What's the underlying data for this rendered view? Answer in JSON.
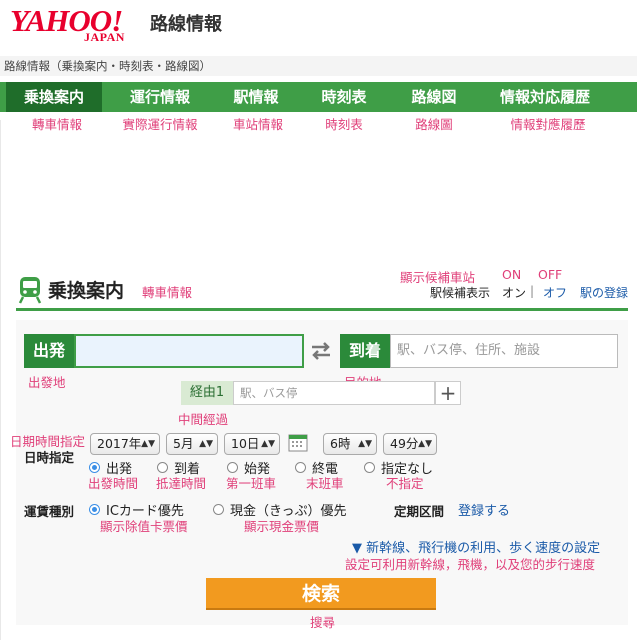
{
  "brand": {
    "logo_text": "YAHOO!",
    "logo_sub": "JAPAN",
    "service_title": "路線情報"
  },
  "breadcrumb": "路線情報（乗換案内・時刻表・路線図）",
  "nav": {
    "tabs": [
      {
        "label": "乗換案内",
        "sub": "轉車情報",
        "active": true
      },
      {
        "label": "運行情報",
        "sub": "實際運行情報"
      },
      {
        "label": "駅情報",
        "sub": "車站情報"
      },
      {
        "label": "時刻表",
        "sub": "時刻表"
      },
      {
        "label": "路線図",
        "sub": "路線圖"
      },
      {
        "label": "情報対応履歴",
        "sub": "情報對應履歷"
      }
    ]
  },
  "candidate": {
    "note": "顯示候補車站",
    "note_on": "ON",
    "note_off": "OFF",
    "label": "駅候補表示",
    "on": "オン",
    "sep": "|",
    "off": "オフ",
    "register": "駅の登録"
  },
  "section": {
    "title": "乗換案内",
    "title_note": "轉車情報"
  },
  "departure": {
    "label": "出発",
    "value": "",
    "note": "出發地"
  },
  "arrival": {
    "label": "到着",
    "placeholder": "駅、バス停、住所、施設",
    "note": "目的地"
  },
  "via": {
    "label": "経由1",
    "placeholder": "駅、バス停",
    "add": "+",
    "note": "中間經過"
  },
  "datetime": {
    "note": "日期時間指定",
    "label": "日時指定",
    "year": "2017年",
    "month": "5月",
    "day": "10日",
    "hour": "6時",
    "minute": "49分",
    "options": [
      {
        "label": "出発",
        "note": "出發時間",
        "checked": true
      },
      {
        "label": "到着",
        "note": "抵達時間"
      },
      {
        "label": "始発",
        "note": "第一班車"
      },
      {
        "label": "終電",
        "note": "末班車"
      },
      {
        "label": "指定なし",
        "note": "不指定"
      }
    ]
  },
  "fare": {
    "label": "運賃種別",
    "options": [
      {
        "label": "ICカード優先",
        "note": "顯示除值卡票價",
        "checked": true
      },
      {
        "label": "現金（きっぷ）優先",
        "note": "顯示現金票價"
      }
    ],
    "commuter_label": "定期区間",
    "commuter_link": "登録する"
  },
  "settings": {
    "link": "▼ 新幹線、飛行機の利用、歩く速度の設定",
    "note": "設定可利用新幹線，飛機，以及您的步行速度"
  },
  "search": {
    "label": "検索",
    "note": "搜尋"
  },
  "colors": {
    "brand_red": "#e8002d",
    "nav_green": "#3f9e47",
    "nav_active": "#1f6d2a",
    "label_green": "#2b8a3a",
    "search_orange": "#f29a1f",
    "annotation_pink": "#e0407a",
    "link_blue": "#1a5aa8"
  }
}
